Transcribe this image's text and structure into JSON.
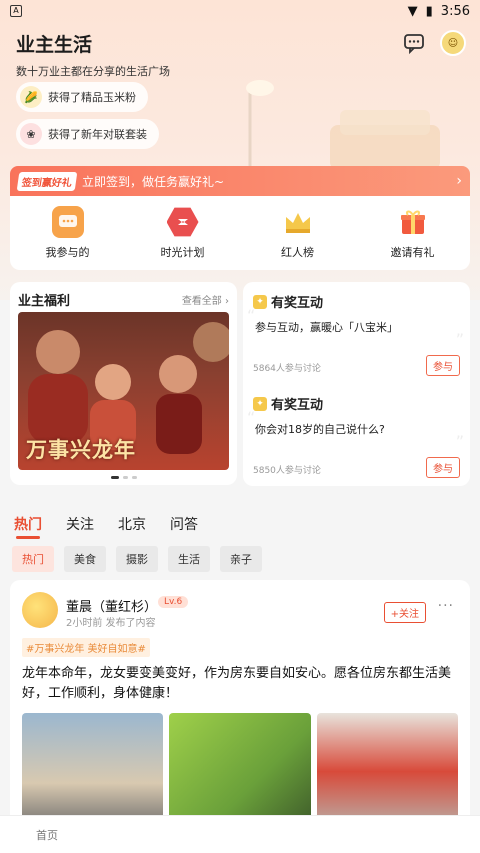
{
  "status_bar": {
    "app_badge": "A",
    "time": "3:56"
  },
  "header": {
    "title": "业主生活",
    "subtitle": "数十万业主都在分享的生活广场"
  },
  "notices": [
    {
      "text": "获得了精品玉米粉"
    },
    {
      "text": "获得了新年对联套装"
    }
  ],
  "sign_banner": {
    "tag": "签到赢好礼",
    "text": "立即签到，做任务赢好礼~"
  },
  "quick_actions": [
    {
      "label": "我参与的",
      "icon": "chat-bubble-icon",
      "color": "#f7a34a"
    },
    {
      "label": "时光计划",
      "icon": "hexagon-clock-icon",
      "color": "#e94f4f"
    },
    {
      "label": "红人榜",
      "icon": "crown-icon",
      "color": "#f5c84b"
    },
    {
      "label": "邀请有礼",
      "icon": "gift-icon",
      "color": "#f15a3e"
    }
  ],
  "welfare": {
    "title": "业主福利",
    "more": "查看全部 ›",
    "banner_text": "万事兴龙年"
  },
  "interactions": [
    {
      "title": "有奖互动",
      "question": "参与互动，赢暖心「八宝米」",
      "count": "5864人参与讨论",
      "button": "参与"
    },
    {
      "title": "有奖互动",
      "question": "你会对18岁的自己说什么?",
      "count": "5850人参与讨论",
      "button": "参与"
    }
  ],
  "tabs": [
    "热门",
    "关注",
    "北京",
    "问答"
  ],
  "chips": [
    "热门",
    "美食",
    "摄影",
    "生活",
    "亲子"
  ],
  "post": {
    "author": "董晨（董红杉）",
    "level": "Lv.6",
    "time": "2小时前 发布了内容",
    "follow": "+关注",
    "more": "···",
    "tag": "#万事兴龙年 美好自如意#",
    "body": "龙年本命年，龙女要变美变好，作为房东要自如安心。愿各位房东都生活美好，工作顺利，身体健康！"
  },
  "bottom_nav": {
    "home": "首页"
  },
  "colors": {
    "accent": "#e94f33",
    "banner": "#f9735b"
  }
}
